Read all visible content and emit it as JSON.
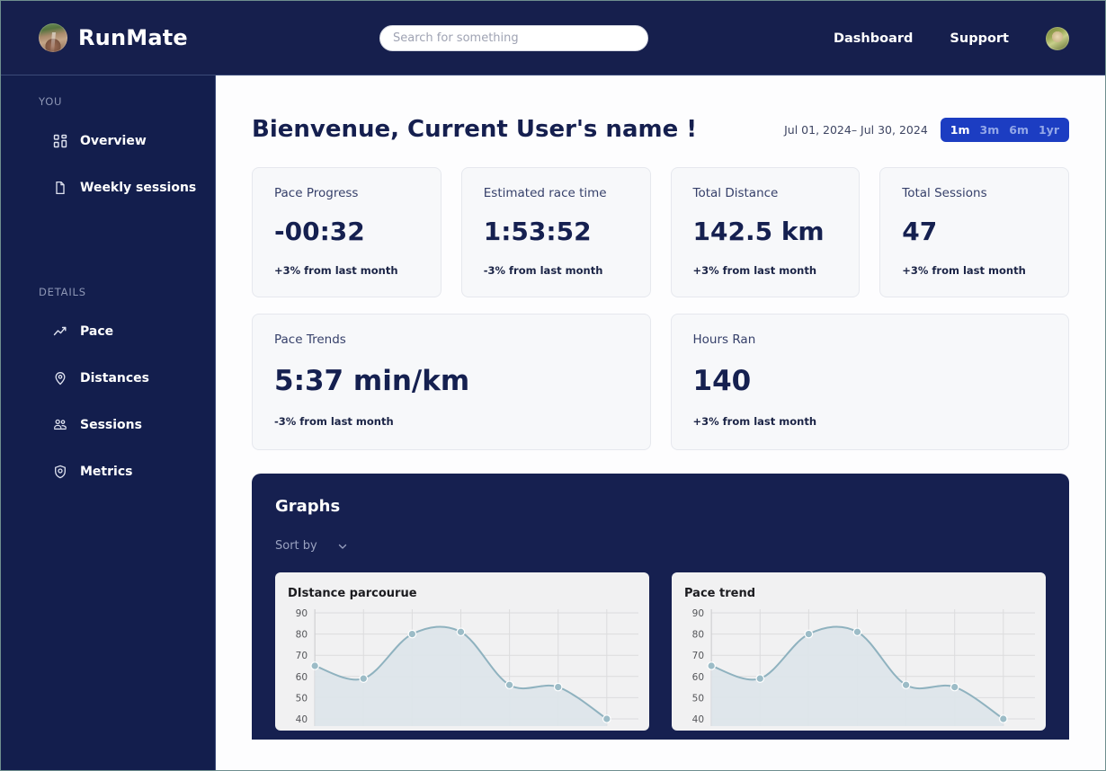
{
  "header": {
    "brand_name": "RunMate",
    "logo_icon": "running-track-photo-logo",
    "search": {
      "placeholder": "Search for something",
      "value": ""
    },
    "nav": [
      {
        "label": "Dashboard",
        "name": "dashboard"
      },
      {
        "label": "Support",
        "name": "support"
      }
    ],
    "avatar_icon": "user-avatar-photo"
  },
  "sidebar": {
    "group_you": "YOU",
    "group_details": "DETAILS",
    "items_you": [
      {
        "label": "Overview",
        "icon": "grid-icon"
      },
      {
        "label": "Weekly sessions",
        "icon": "file-icon"
      }
    ],
    "items_details": [
      {
        "label": "Pace",
        "icon": "trending-up-icon"
      },
      {
        "label": "Distances",
        "icon": "map-pin-icon"
      },
      {
        "label": "Sessions",
        "icon": "users-icon"
      },
      {
        "label": "Metrics",
        "icon": "shield-check-icon"
      }
    ]
  },
  "page": {
    "title": "Bienvenue, Current User's name !",
    "date_range": "Jul 01, 2024– Jul 30, 2024",
    "range_options": [
      {
        "label": "1m",
        "active": true
      },
      {
        "label": "3m",
        "active": false
      },
      {
        "label": "6m",
        "active": false
      },
      {
        "label": "1yr",
        "active": false
      }
    ]
  },
  "stats_row1": [
    {
      "label": "Pace Progress",
      "value": "-00:32",
      "delta": "+3% from last month"
    },
    {
      "label": "Estimated race time",
      "value": "1:53:52",
      "delta": "-3% from last month"
    },
    {
      "label": "Total Distance",
      "value": "142.5 km",
      "delta": "+3% from last month"
    },
    {
      "label": "Total Sessions",
      "value": "47",
      "delta": "+3% from last month"
    }
  ],
  "stats_row2": [
    {
      "label": "Pace Trends",
      "value": "5:37 min/km",
      "delta": "-3% from last month"
    },
    {
      "label": "Hours Ran",
      "value": "140",
      "delta": "+3% from last month"
    }
  ],
  "graphs": {
    "title": "Graphs",
    "sort_label": "Sort by",
    "sort_icon": "chevron-down-icon"
  },
  "colors": {
    "navy": "#161f4d",
    "panel_navy": "#162050",
    "accent_blue": "#1c3dc2",
    "card_bg": "#f7f8fa",
    "chart_line": "#8fb2bf",
    "chart_fill": "#dde5ea"
  },
  "chart_data": [
    {
      "type": "area",
      "title": "DIstance parcourue",
      "xlabel": "",
      "ylabel": "",
      "ylim": [
        40,
        90
      ],
      "yticks": [
        90,
        80,
        70,
        60,
        50,
        40
      ],
      "grid": true,
      "legend": "none",
      "x": [
        0,
        1,
        2,
        3,
        4,
        5,
        6
      ],
      "values": [
        65,
        59,
        80,
        81,
        56,
        55,
        40
      ]
    },
    {
      "type": "area",
      "title": "Pace trend",
      "xlabel": "",
      "ylabel": "",
      "ylim": [
        40,
        90
      ],
      "yticks": [
        90,
        80,
        70,
        60,
        50,
        40
      ],
      "grid": true,
      "legend": "none",
      "x": [
        0,
        1,
        2,
        3,
        4,
        5,
        6
      ],
      "values": [
        65,
        59,
        80,
        81,
        56,
        55,
        40
      ]
    }
  ]
}
